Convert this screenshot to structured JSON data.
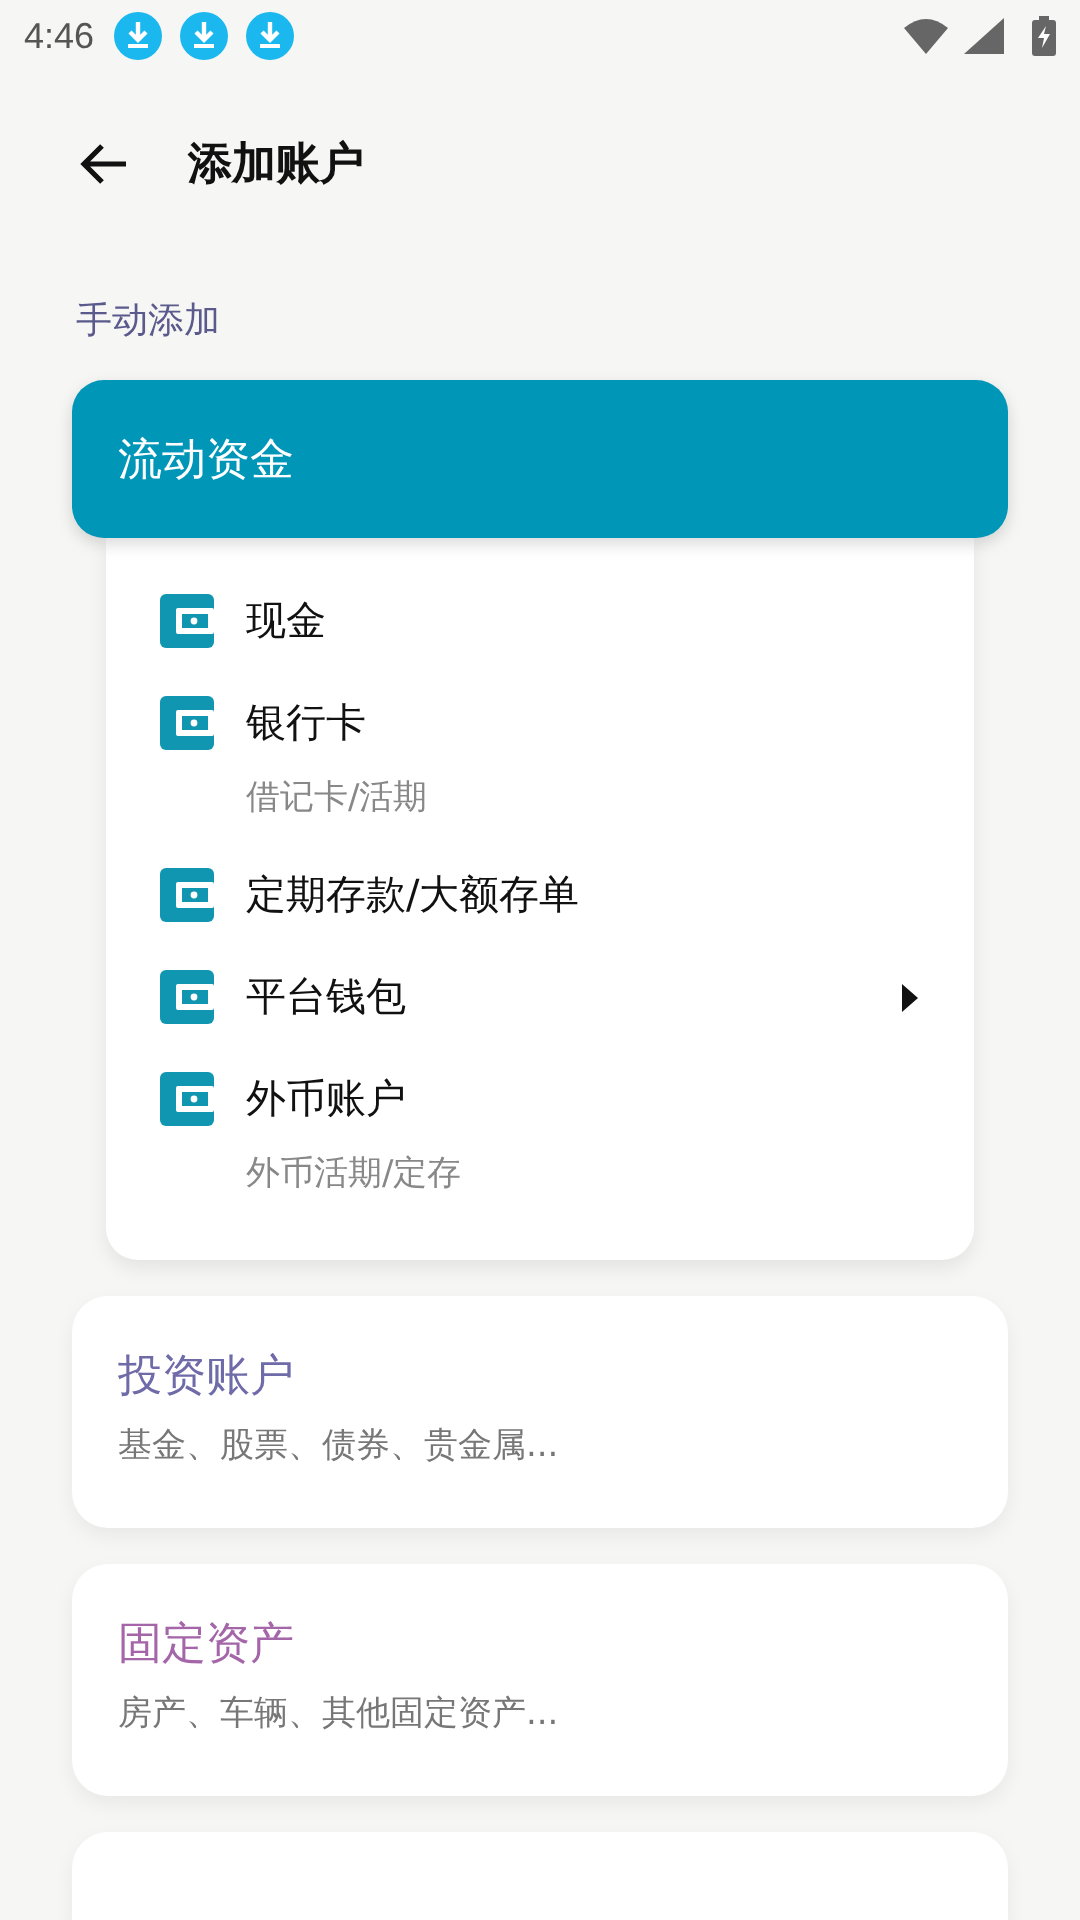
{
  "status_bar": {
    "time": "4:46",
    "notifications": [
      {
        "kind": "download"
      },
      {
        "kind": "download"
      },
      {
        "kind": "download"
      }
    ]
  },
  "header": {
    "title": "添加账户"
  },
  "section_label": "手动添加",
  "categories": [
    {
      "title": "流动资金",
      "color": "#0096b8",
      "expanded": true,
      "items": [
        {
          "label": "现金",
          "submenu": false
        },
        {
          "label": "银行卡",
          "sublabel": "借记卡/活期",
          "submenu": false
        },
        {
          "label": "定期存款/大额存单",
          "submenu": false
        },
        {
          "label": "平台钱包",
          "submenu": true
        },
        {
          "label": "外币账户",
          "sublabel": "外币活期/定存",
          "submenu": false
        }
      ]
    },
    {
      "title": "投资账户",
      "subtitle": "基金、股票、债券、贵金属...",
      "color": "#6f6aa8",
      "expanded": false
    },
    {
      "title": "固定资产",
      "subtitle": "房产、车辆、其他固定资产...",
      "color": "#a466a8",
      "expanded": false
    }
  ]
}
